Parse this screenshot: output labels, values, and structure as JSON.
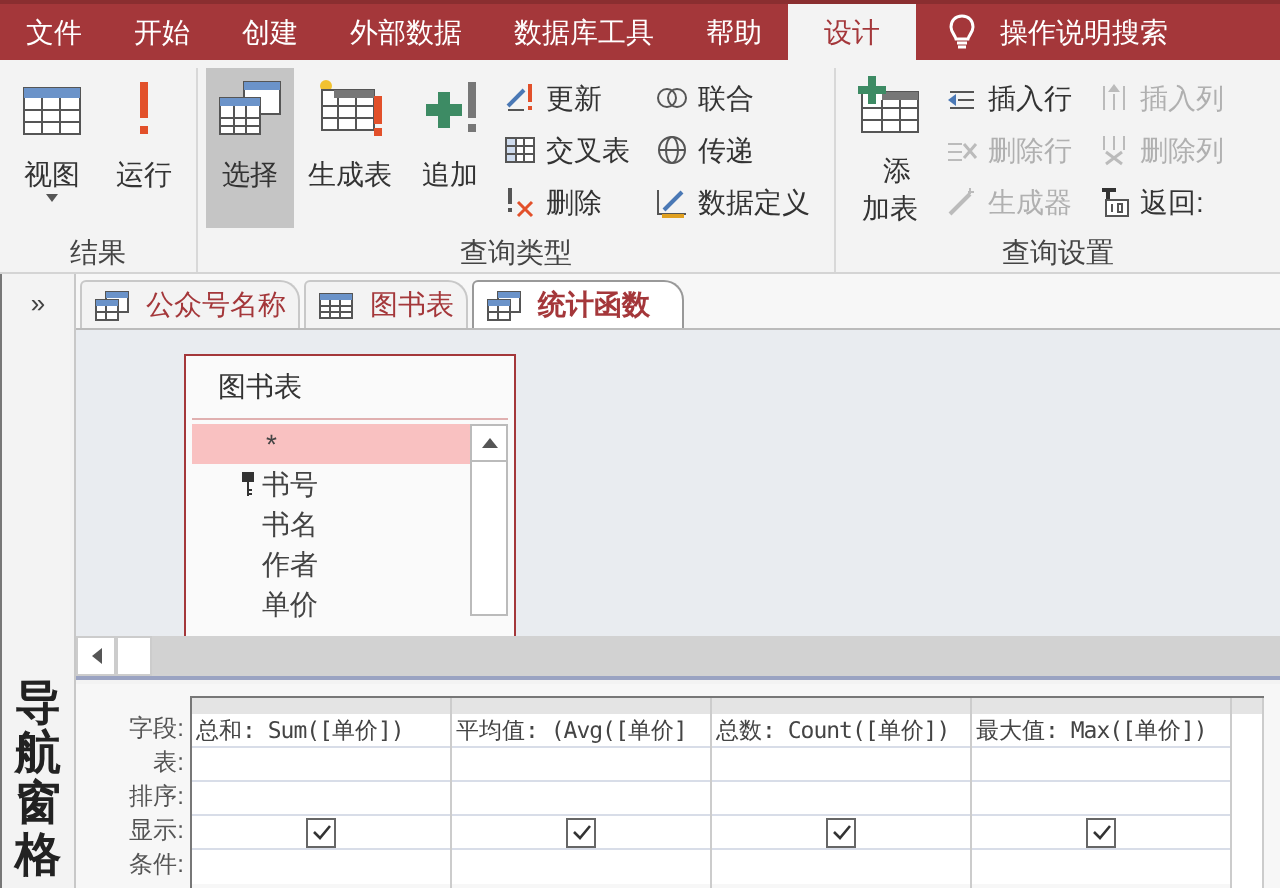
{
  "menu_tabs": [
    {
      "label": "文件",
      "selected": false
    },
    {
      "label": "开始",
      "selected": false
    },
    {
      "label": "创建",
      "selected": false
    },
    {
      "label": "外部数据",
      "selected": false
    },
    {
      "label": "数据库工具",
      "selected": false
    },
    {
      "label": "帮助",
      "selected": false
    },
    {
      "label": "设计",
      "selected": true
    }
  ],
  "search_label": "操作说明搜索",
  "ribbon_groups": [
    {
      "title": "结果",
      "columns": [
        [
          {
            "label": "视图",
            "kind": "large_split",
            "selected": false,
            "disabled": false
          },
          {
            "label": "运行",
            "kind": "large",
            "selected": false,
            "disabled": false
          }
        ]
      ]
    },
    {
      "title": "查询类型",
      "columns": [
        [
          {
            "label": "选择",
            "kind": "large",
            "selected": true,
            "disabled": false
          },
          {
            "label": "生成表",
            "kind": "large",
            "selected": false,
            "disabled": false
          },
          {
            "label": "追加",
            "kind": "large",
            "selected": false,
            "disabled": false
          }
        ],
        [
          {
            "label": "更新",
            "kind": "small",
            "selected": false,
            "disabled": false
          },
          {
            "label": "交叉表",
            "kind": "small",
            "selected": false,
            "disabled": false
          },
          {
            "label": "删除",
            "kind": "small",
            "selected": false,
            "disabled": false
          }
        ],
        [
          {
            "label": "联合",
            "kind": "small",
            "selected": false,
            "disabled": false
          },
          {
            "label": "传递",
            "kind": "small",
            "selected": false,
            "disabled": false
          },
          {
            "label": "数据定义",
            "kind": "small",
            "selected": false,
            "disabled": false
          }
        ]
      ]
    },
    {
      "title": "查询设置",
      "columns": [
        [
          {
            "label": "添加表",
            "kind": "large_wrapped",
            "selected": false,
            "disabled": false
          }
        ],
        [
          {
            "label": "插入行",
            "kind": "small",
            "selected": false,
            "disabled": false
          },
          {
            "label": "删除行",
            "kind": "small",
            "selected": false,
            "disabled": true
          },
          {
            "label": "生成器",
            "kind": "small",
            "selected": false,
            "disabled": true
          }
        ],
        [
          {
            "label": "插入列",
            "kind": "small",
            "selected": false,
            "disabled": true
          },
          {
            "label": "删除列",
            "kind": "small",
            "selected": false,
            "disabled": true
          },
          {
            "label": "返回:",
            "kind": "small",
            "selected": false,
            "disabled": false
          }
        ]
      ]
    }
  ],
  "nav_pane": {
    "toggle": "»",
    "label": "导航窗格"
  },
  "doc_tabs": [
    {
      "label": "公众号名称",
      "kind": "query",
      "selected": false
    },
    {
      "label": "图书表",
      "kind": "table",
      "selected": false
    },
    {
      "label": "统计函数",
      "kind": "query",
      "selected": true
    }
  ],
  "table_box": {
    "title": "图书表",
    "fields": [
      {
        "label": "*",
        "kind": "all",
        "selected": true
      },
      {
        "label": "书号",
        "kind": "key",
        "selected": false
      },
      {
        "label": "书名",
        "kind": "field",
        "selected": false
      },
      {
        "label": "作者",
        "kind": "field",
        "selected": false
      },
      {
        "label": "单价",
        "kind": "field",
        "selected": false
      }
    ]
  },
  "grid": {
    "row_labels": [
      "字段:",
      "表:",
      "排序:",
      "显示:",
      "条件:"
    ],
    "columns": [
      {
        "field": "总和: Sum([单价])",
        "show": true
      },
      {
        "field": "平均值: (Avg([单价]",
        "show": true
      },
      {
        "field": "总数: Count([单价])",
        "show": true
      },
      {
        "field": "最大值: Max([单价])",
        "show": true
      }
    ]
  }
}
